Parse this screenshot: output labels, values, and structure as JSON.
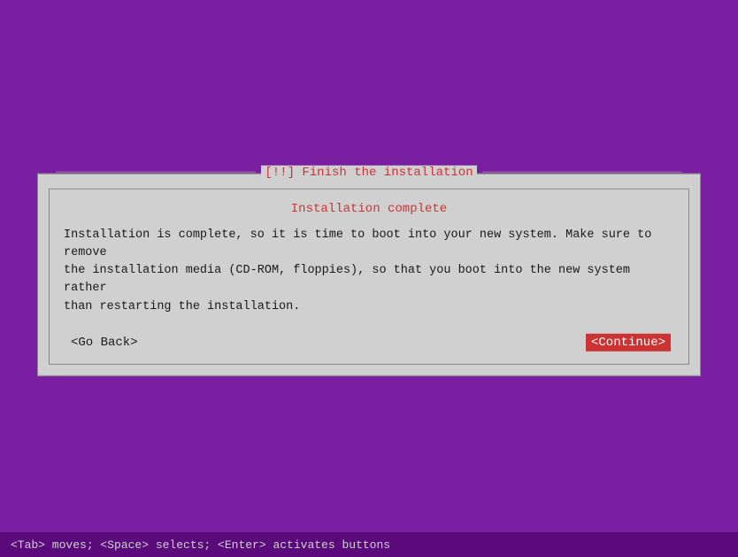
{
  "background_color": "#7b1fa2",
  "dialog": {
    "title": "[!!] Finish the installation",
    "subtitle": "Installation complete",
    "body_lines": [
      "Installation is complete, so it is time to boot into your new system. Make sure to remove",
      "the installation media (CD-ROM, floppies), so that you boot into the new system rather",
      "than restarting the installation."
    ],
    "go_back_label": "<Go Back>",
    "continue_label": "<Continue>"
  },
  "status_bar": {
    "text": "<Tab> moves; <Space> selects; <Enter> activates buttons"
  }
}
